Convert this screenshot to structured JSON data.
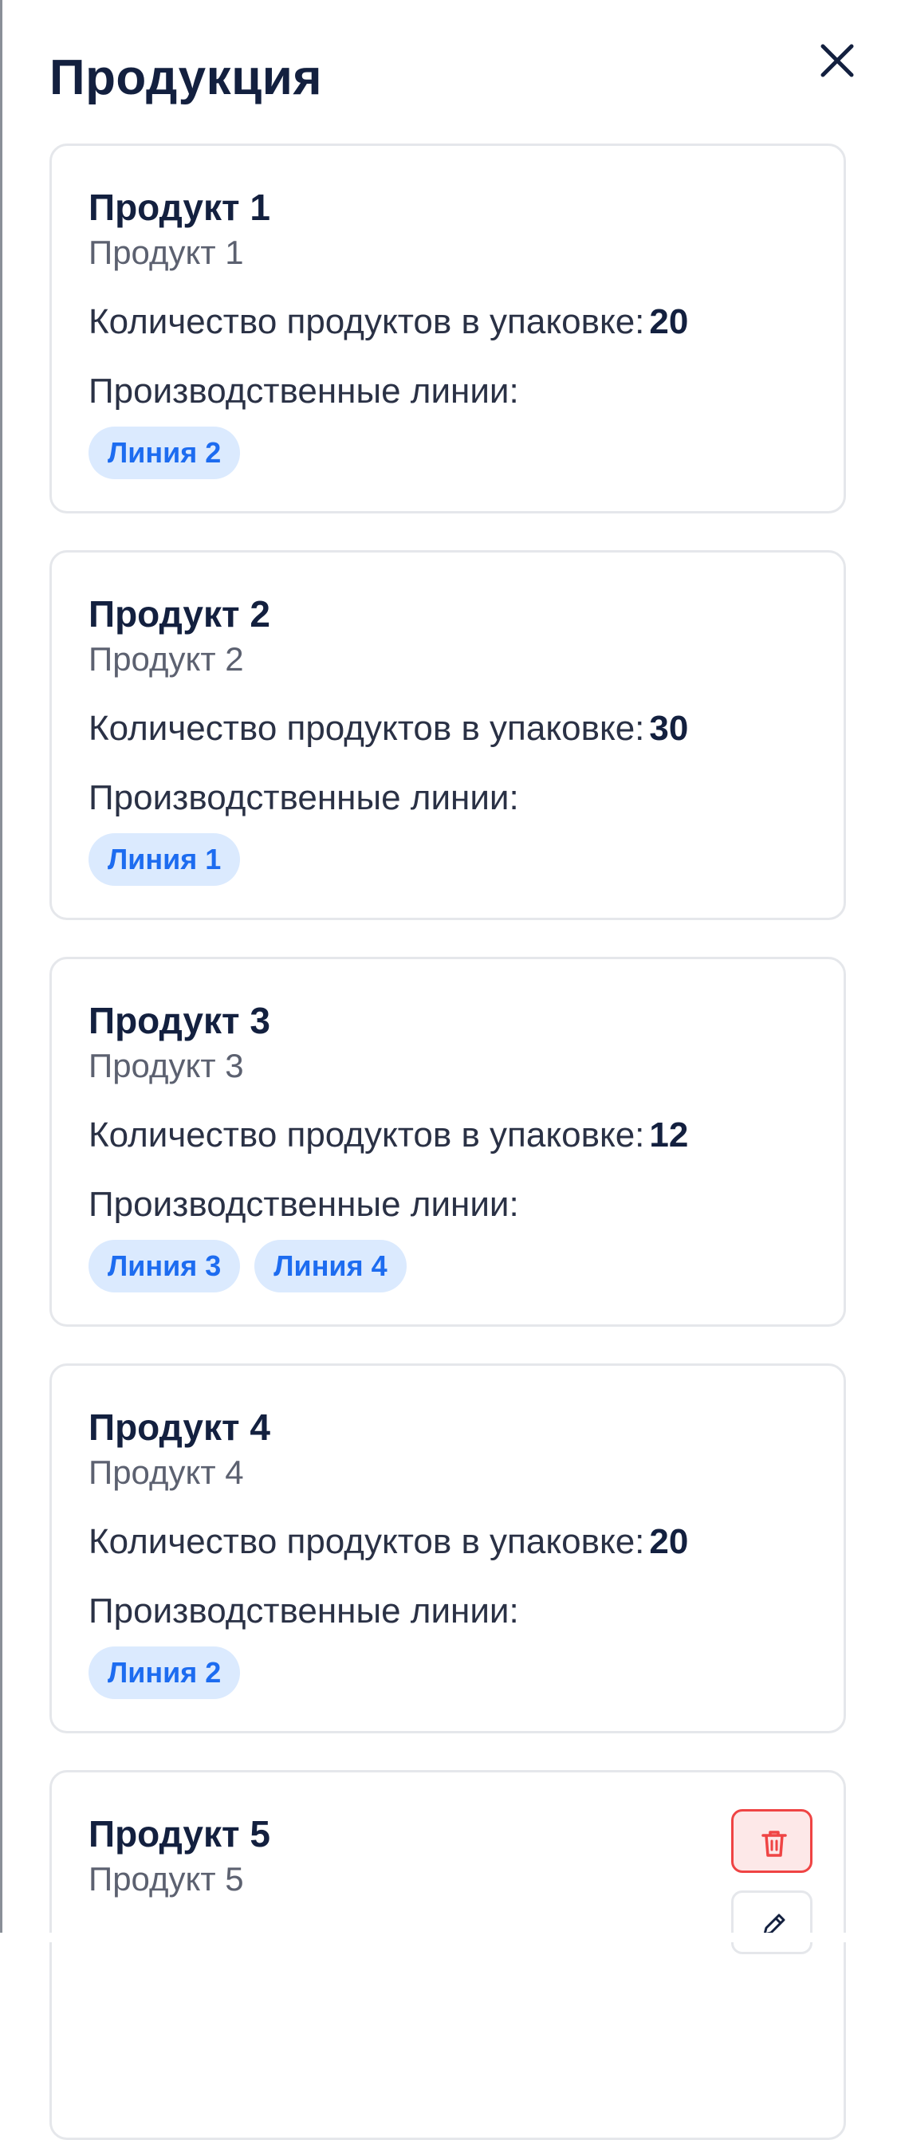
{
  "header": {
    "title": "Продукция"
  },
  "icons": {
    "close": "close-icon",
    "delete": "trash-icon",
    "edit": "pencil-icon"
  },
  "colors": {
    "chip_text": "#1d6cf0",
    "chip_bg": "#dbeafe",
    "delete_border": "#ef4444",
    "title": "#13203f"
  },
  "products": [
    {
      "title": "Продукт 1",
      "subtitle": "Продукт 1",
      "qty_label": "Количество продуктов в упаковке:",
      "qty_value": "20",
      "lines_label": "Производственные линии:",
      "lines": [
        "Линия 2"
      ]
    },
    {
      "title": "Продукт 2",
      "subtitle": "Продукт 2",
      "qty_label": "Количество продуктов в упаковке:",
      "qty_value": "30",
      "lines_label": "Производственные линии:",
      "lines": [
        "Линия 1"
      ]
    },
    {
      "title": "Продукт 3",
      "subtitle": "Продукт 3",
      "qty_label": "Количество продуктов в упаковке:",
      "qty_value": "12",
      "lines_label": "Производственные линии:",
      "lines": [
        "Линия 3",
        "Линия 4"
      ]
    },
    {
      "title": "Продукт 4",
      "subtitle": "Продукт 4",
      "qty_label": "Количество продуктов в упаковке:",
      "qty_value": "20",
      "lines_label": "Производственные линии:",
      "lines": [
        "Линия 2"
      ]
    },
    {
      "title": "Продукт 5",
      "subtitle": "Продукт 5"
    }
  ]
}
